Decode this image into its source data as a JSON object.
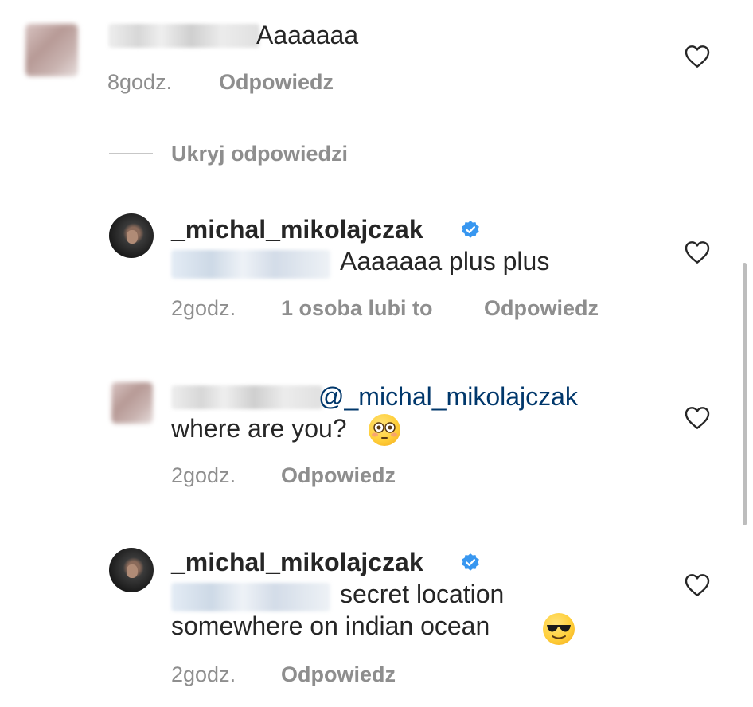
{
  "comments": [
    {
      "text": "Aaaaaaa",
      "time": "8godz.",
      "reply_label": "Odpowiedz"
    },
    {
      "username": "_michal_mikolajczak",
      "text": "Aaaaaaa plus plus",
      "time": "2godz.",
      "likes": "1 osoba lubi to",
      "reply_label": "Odpowiedz"
    },
    {
      "mention": "@_michal_mikolajczak",
      "text": "where are you?",
      "time": "2godz.",
      "reply_label": "Odpowiedz"
    },
    {
      "username": "_michal_mikolajczak",
      "text_line1": "secret location",
      "text_line2": "somewhere on indian ocean",
      "time": "2godz.",
      "reply_label": "Odpowiedz"
    }
  ],
  "hide_replies_label": "Ukryj odpowiedzi",
  "icons": {
    "heart": "heart-outline-icon",
    "verified": "verified-badge-icon",
    "emoji_flushed": "flushed-face-emoji",
    "emoji_sunglasses": "sunglasses-face-emoji"
  },
  "colors": {
    "text": "#262626",
    "secondary": "#8e8e8e",
    "mention": "#00376b",
    "verified": "#3897f0"
  }
}
